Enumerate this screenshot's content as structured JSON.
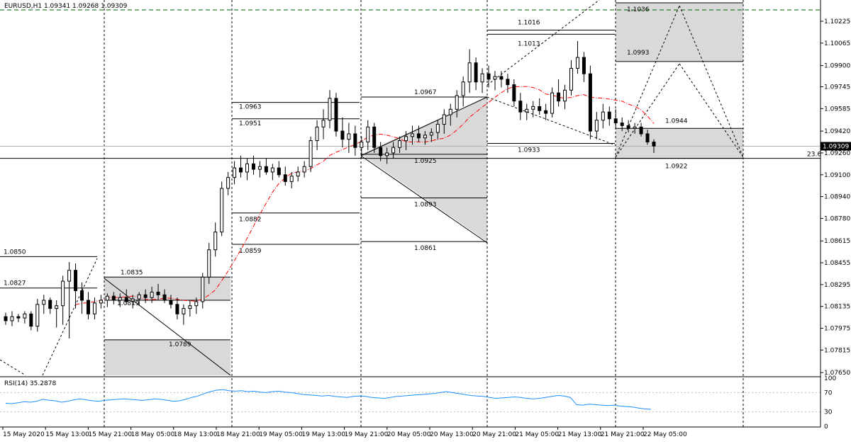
{
  "chart_data": {
    "type": "candlestick",
    "title": "EURUSD,H1  1.09341 1.09268 1.09309",
    "symbol": "EURUSD",
    "timeframe": "H1",
    "ohlc_readout": [
      "1.09341",
      "1.09268",
      "1.09309"
    ],
    "current_price": 1.09309,
    "current_price_label": "1.09309",
    "ylim": [
      1.0763,
      1.1036
    ],
    "y_ticks": [
      "1.10225",
      "1.10065",
      "1.09900",
      "1.09745",
      "1.09585",
      "1.09420",
      "1.09260",
      "1.09100",
      "1.08940",
      "1.08780",
      "1.08615",
      "1.08455",
      "1.08295",
      "1.08135",
      "1.07975",
      "1.07815",
      "1.07650"
    ],
    "x_ticks": [
      "15 May 2020",
      "15 May 13:00",
      "15 May 21:00",
      "18 May 05:00",
      "18 May 13:00",
      "18 May 21:00",
      "19 May 05:00",
      "19 May 13:00",
      "19 May 21:00",
      "20 May 05:00",
      "20 May 13:00",
      "20 May 21:00",
      "21 May 05:00",
      "21 May 13:00",
      "21 May 21:00",
      "22 May 05:00"
    ],
    "grid": false,
    "candles": [
      [
        1.0806,
        1.0809,
        1.08,
        1.0803
      ],
      [
        1.0803,
        1.081,
        1.0799,
        1.0806
      ],
      [
        1.0806,
        1.0808,
        1.0802,
        1.0805
      ],
      [
        1.0805,
        1.081,
        1.0801,
        1.0808
      ],
      [
        1.0808,
        1.081,
        1.0796,
        1.0799
      ],
      [
        1.0799,
        1.0819,
        1.0795,
        1.0815
      ],
      [
        1.0815,
        1.0822,
        1.0808,
        1.0818
      ],
      [
        1.0818,
        1.082,
        1.0808,
        1.0812
      ],
      [
        1.0812,
        1.0818,
        1.0798,
        1.0814
      ],
      [
        1.0814,
        1.0836,
        1.08,
        1.0832
      ],
      [
        1.0832,
        1.0846,
        1.079,
        1.084
      ],
      [
        1.084,
        1.0845,
        1.0812,
        1.0825
      ],
      [
        1.0825,
        1.0831,
        1.0808,
        1.0818
      ],
      [
        1.0818,
        1.0824,
        1.0804,
        1.0808
      ],
      [
        1.0808,
        1.082,
        1.0804,
        1.0816
      ],
      [
        1.0816,
        1.0822,
        1.0812,
        1.0818
      ],
      [
        1.0818,
        1.0823,
        1.0813,
        1.0821
      ],
      [
        1.0821,
        1.0824,
        1.0815,
        1.0818
      ],
      [
        1.0818,
        1.0823,
        1.0813,
        1.082
      ],
      [
        1.082,
        1.0826,
        1.0815,
        1.0817
      ],
      [
        1.0817,
        1.0822,
        1.0812,
        1.0819
      ],
      [
        1.0819,
        1.0824,
        1.0814,
        1.0822
      ],
      [
        1.0822,
        1.0826,
        1.0816,
        1.082
      ],
      [
        1.082,
        1.0828,
        1.0816,
        1.0824
      ],
      [
        1.0824,
        1.083,
        1.0818,
        1.0822
      ],
      [
        1.0822,
        1.0826,
        1.0816,
        1.0818
      ],
      [
        1.0818,
        1.0822,
        1.0812,
        1.0815
      ],
      [
        1.0815,
        1.082,
        1.0804,
        1.0808
      ],
      [
        1.0808,
        1.0815,
        1.08,
        1.0812
      ],
      [
        1.0812,
        1.0818,
        1.0806,
        1.0814
      ],
      [
        1.0814,
        1.082,
        1.0808,
        1.0817
      ],
      [
        1.0817,
        1.0838,
        1.0812,
        1.0835
      ],
      [
        1.0835,
        1.086,
        1.083,
        1.0855
      ],
      [
        1.0855,
        1.0875,
        1.085,
        1.0868
      ],
      [
        1.0868,
        1.0905,
        1.0865,
        1.09
      ],
      [
        1.09,
        1.0912,
        1.0895,
        1.0908
      ],
      [
        1.0908,
        1.092,
        1.0903,
        1.0915
      ],
      [
        1.0915,
        1.0924,
        1.0908,
        1.0912
      ],
      [
        1.0912,
        1.0922,
        1.0906,
        1.0918
      ],
      [
        1.0918,
        1.0924,
        1.091,
        1.0914
      ],
      [
        1.0914,
        1.092,
        1.0908,
        1.0916
      ],
      [
        1.0916,
        1.0922,
        1.091,
        1.0912
      ],
      [
        1.0912,
        1.0918,
        1.0906,
        1.0915
      ],
      [
        1.0915,
        1.092,
        1.0908,
        1.091
      ],
      [
        1.091,
        1.0916,
        1.0902,
        1.0905
      ],
      [
        1.0905,
        1.0912,
        1.09,
        1.0909
      ],
      [
        1.0909,
        1.0916,
        1.0905,
        1.0912
      ],
      [
        1.0912,
        1.092,
        1.0908,
        1.0916
      ],
      [
        1.0916,
        1.0938,
        1.0912,
        1.0935
      ],
      [
        1.0935,
        1.095,
        1.0928,
        1.0945
      ],
      [
        1.0945,
        1.0958,
        1.0936,
        1.095
      ],
      [
        1.095,
        1.0972,
        1.0944,
        1.0966
      ],
      [
        1.0966,
        1.097,
        1.0938,
        1.0942
      ],
      [
        1.0942,
        1.0952,
        1.093,
        1.0936
      ],
      [
        1.0936,
        1.0948,
        1.0926,
        1.094
      ],
      [
        1.094,
        1.0946,
        1.0924,
        1.093
      ],
      [
        1.093,
        1.0938,
        1.0922,
        1.0934
      ],
      [
        1.0934,
        1.095,
        1.0928,
        1.0945
      ],
      [
        1.0945,
        1.0948,
        1.0926,
        1.093
      ],
      [
        1.093,
        1.0934,
        1.092,
        1.0924
      ],
      [
        1.0924,
        1.093,
        1.0918,
        1.0926
      ],
      [
        1.0926,
        1.0934,
        1.0922,
        1.093
      ],
      [
        1.093,
        1.0938,
        1.0926,
        1.0935
      ],
      [
        1.0935,
        1.0942,
        1.0928,
        1.0938
      ],
      [
        1.0938,
        1.0946,
        1.0932,
        1.094
      ],
      [
        1.094,
        1.0946,
        1.0934,
        1.0937
      ],
      [
        1.0937,
        1.0942,
        1.0932,
        1.0939
      ],
      [
        1.0939,
        1.0944,
        1.0934,
        1.0941
      ],
      [
        1.0941,
        1.095,
        1.0936,
        1.0947
      ],
      [
        1.0947,
        1.0958,
        1.094,
        1.0954
      ],
      [
        1.0954,
        1.0962,
        1.0946,
        1.0958
      ],
      [
        1.0958,
        1.0972,
        1.0952,
        1.0968
      ],
      [
        1.0968,
        1.0982,
        1.096,
        1.0978
      ],
      [
        1.0978,
        1.1002,
        1.097,
        1.0992
      ],
      [
        1.0992,
        1.0996,
        1.0972,
        1.0978
      ],
      [
        1.0978,
        1.0988,
        1.097,
        1.0984
      ],
      [
        1.0984,
        1.099,
        1.0974,
        1.098
      ],
      [
        1.098,
        1.0986,
        1.0972,
        1.0982
      ],
      [
        1.0982,
        1.0986,
        1.0974,
        1.098
      ],
      [
        1.098,
        1.0984,
        1.097,
        1.0976
      ],
      [
        1.0976,
        1.098,
        1.096,
        1.0964
      ],
      [
        1.0964,
        1.097,
        1.095,
        1.0956
      ],
      [
        1.0956,
        1.0962,
        1.095,
        1.0958
      ],
      [
        1.0958,
        1.0964,
        1.0952,
        1.096
      ],
      [
        1.096,
        1.0966,
        1.0954,
        1.0957
      ],
      [
        1.0957,
        1.0962,
        1.095,
        1.0955
      ],
      [
        1.0955,
        1.0974,
        1.0952,
        1.097
      ],
      [
        1.097,
        1.098,
        1.096,
        1.0964
      ],
      [
        1.0964,
        1.0976,
        1.0958,
        1.0972
      ],
      [
        1.0972,
        1.0994,
        1.0968,
        1.0988
      ],
      [
        1.0988,
        1.1008,
        1.0984,
        1.0996
      ],
      [
        1.0996,
        1.1,
        1.0978,
        1.0984
      ],
      [
        1.0984,
        1.099,
        1.0936,
        1.0942
      ],
      [
        1.0942,
        1.0956,
        1.0936,
        1.095
      ],
      [
        1.095,
        1.0962,
        1.0944,
        1.0956
      ],
      [
        1.0956,
        1.096,
        1.0946,
        1.0951
      ],
      [
        1.0951,
        1.0958,
        1.0944,
        1.0948
      ],
      [
        1.0948,
        1.0952,
        1.0942,
        1.0946
      ],
      [
        1.0946,
        1.095,
        1.0941,
        1.0944
      ],
      [
        1.0944,
        1.0948,
        1.094,
        1.0945
      ],
      [
        1.0945,
        1.0948,
        1.0938,
        1.094
      ],
      [
        1.094,
        1.0943,
        1.0932,
        1.0934
      ],
      [
        1.0934,
        1.0936,
        1.0926,
        1.0931
      ]
    ],
    "annotations": [
      "1.0850",
      "1.0827",
      "1.0835",
      "1.0819",
      "1.0789",
      "1.0963",
      "1.0951",
      "1.0882",
      "1.0859",
      "1.0967",
      "1.0925",
      "1.0893",
      "1.0861",
      "1.1016",
      "1.1013",
      "1.0933",
      "1.1036",
      "1.0993",
      "1.0944",
      "1.0922",
      "23.6"
    ],
    "indicator": {
      "label": "RSI(14) 35.2878",
      "ylim": [
        0,
        100
      ],
      "y_ticks": [
        "100",
        "70",
        "30",
        "0"
      ],
      "values": [
        48,
        47,
        49,
        51,
        50,
        52,
        56,
        54,
        53,
        50,
        52,
        55,
        57,
        55,
        53,
        52,
        54,
        55,
        56,
        57,
        56,
        55,
        54,
        55,
        57,
        56,
        54,
        52,
        53,
        56,
        60,
        63,
        68,
        72,
        75,
        76,
        74,
        73,
        74,
        72,
        73,
        71,
        70,
        72,
        73,
        71,
        70,
        68,
        66,
        65,
        64,
        63,
        64,
        62,
        61,
        60,
        62,
        63,
        62,
        60,
        59,
        58,
        60,
        62,
        63,
        64,
        65,
        66,
        67,
        68,
        70,
        72,
        70,
        68,
        66,
        64,
        63,
        62,
        60,
        58,
        59,
        60,
        61,
        60,
        58,
        57,
        58,
        60,
        62,
        64,
        63,
        60,
        45,
        44,
        46,
        45,
        44,
        43,
        44,
        42,
        41,
        40,
        38,
        36,
        35.3
      ]
    },
    "colors": {
      "bull": "#ffffff",
      "bear": "#000000",
      "ma": "#ff0000",
      "rsi": "#1e90ff",
      "zone": "#d9d9d9"
    }
  },
  "ui": {
    "title_text": "EURUSD,H1  1.09341 1.09268 1.09309",
    "price_tag": "1.09309"
  }
}
